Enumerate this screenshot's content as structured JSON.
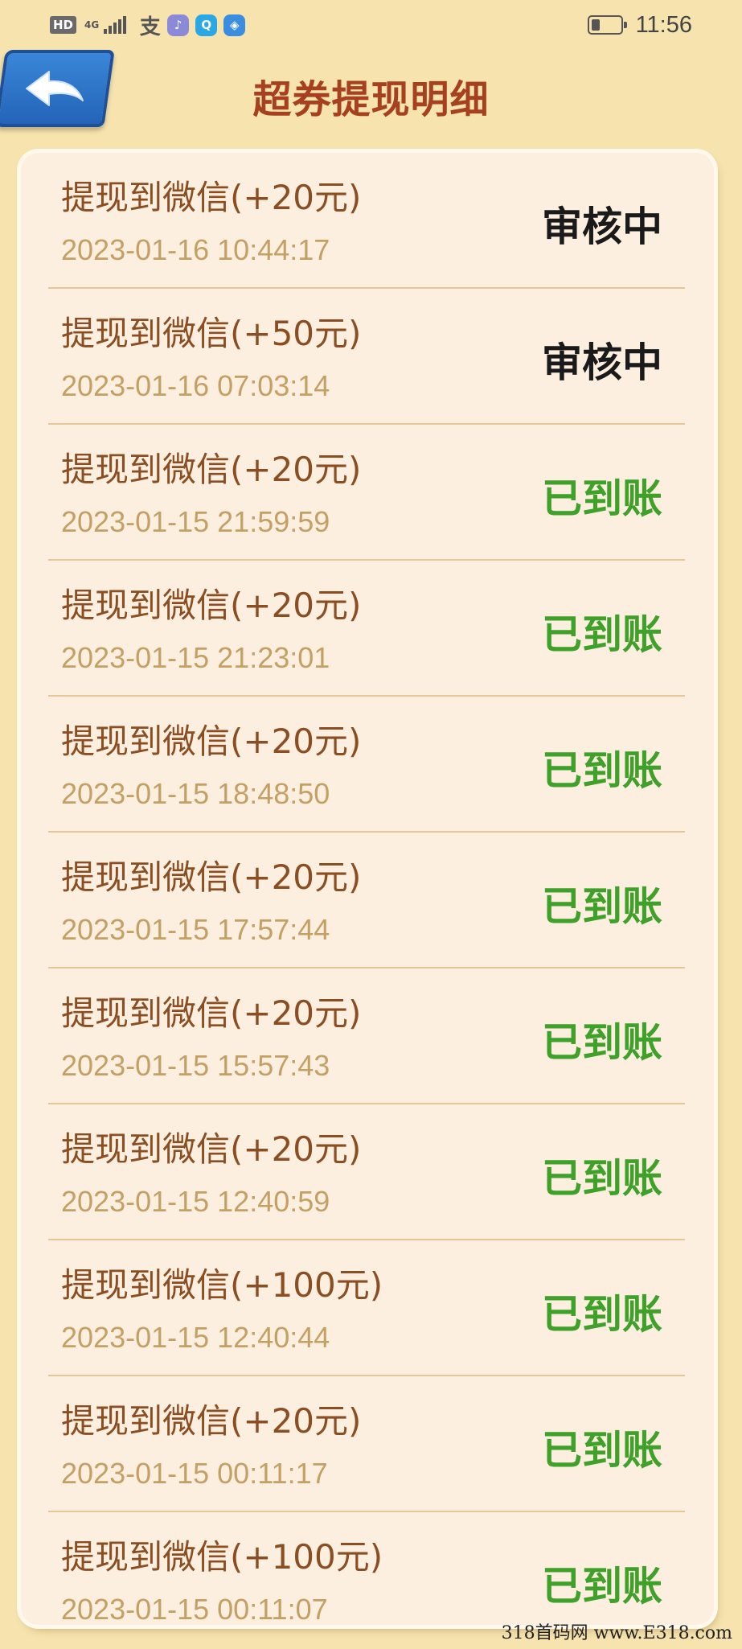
{
  "status_bar": {
    "hd": "HD",
    "network": "4G",
    "apps": [
      {
        "icon": "alipay-icon",
        "glyph": "支",
        "color": "#555555"
      },
      {
        "icon": "music-icon",
        "glyph": "♪",
        "color": "#8a8ad8"
      },
      {
        "icon": "search-app-icon",
        "glyph": "Q",
        "color": "#2aa8e6"
      },
      {
        "icon": "browser-icon",
        "glyph": "◈",
        "color": "#3b8de0"
      }
    ],
    "time": "11:56"
  },
  "header": {
    "title": "超券提现明细"
  },
  "colors": {
    "pending": "#1a1a1a",
    "arrived": "#3fa02a"
  },
  "records": [
    {
      "title": "提现到微信(+20元)",
      "time": "2023-01-16 10:44:17",
      "status": "审核中",
      "state": "pending"
    },
    {
      "title": "提现到微信(+50元)",
      "time": "2023-01-16 07:03:14",
      "status": "审核中",
      "state": "pending"
    },
    {
      "title": "提现到微信(+20元)",
      "time": "2023-01-15 21:59:59",
      "status": "已到账",
      "state": "arrived"
    },
    {
      "title": "提现到微信(+20元)",
      "time": "2023-01-15 21:23:01",
      "status": "已到账",
      "state": "arrived"
    },
    {
      "title": "提现到微信(+20元)",
      "time": "2023-01-15 18:48:50",
      "status": "已到账",
      "state": "arrived"
    },
    {
      "title": "提现到微信(+20元)",
      "time": "2023-01-15 17:57:44",
      "status": "已到账",
      "state": "arrived"
    },
    {
      "title": "提现到微信(+20元)",
      "time": "2023-01-15 15:57:43",
      "status": "已到账",
      "state": "arrived"
    },
    {
      "title": "提现到微信(+20元)",
      "time": "2023-01-15 12:40:59",
      "status": "已到账",
      "state": "arrived"
    },
    {
      "title": "提现到微信(+100元)",
      "time": "2023-01-15 12:40:44",
      "status": "已到账",
      "state": "arrived"
    },
    {
      "title": "提现到微信(+20元)",
      "time": "2023-01-15 00:11:17",
      "status": "已到账",
      "state": "arrived"
    },
    {
      "title": "提现到微信(+100元)",
      "time": "2023-01-15 00:11:07",
      "status": "已到账",
      "state": "arrived"
    }
  ],
  "watermark": "318首码网 www.E318.com"
}
